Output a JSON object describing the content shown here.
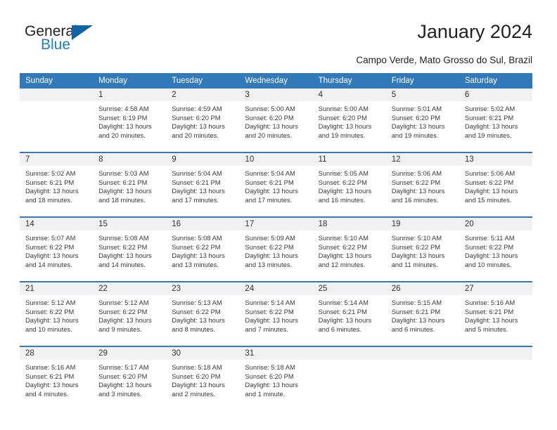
{
  "brand": {
    "word1": "General",
    "word2": "Blue",
    "color_dark": "#231f20",
    "color_blue": "#1b7fc4",
    "triangle_color": "#1064a5"
  },
  "header": {
    "title": "January 2024",
    "subtitle": "Campo Verde, Mato Grosso do Sul, Brazil"
  },
  "calendar": {
    "header_background": "#3179b8",
    "daynum_background": "#f1f1f1",
    "weekdays": [
      "Sunday",
      "Monday",
      "Tuesday",
      "Wednesday",
      "Thursday",
      "Friday",
      "Saturday"
    ],
    "weeks": [
      [
        {
          "day": "",
          "blank": true
        },
        {
          "day": "1",
          "sunrise": "Sunrise: 4:58 AM",
          "sunset": "Sunset: 6:19 PM",
          "daylight1": "Daylight: 13 hours",
          "daylight2": "and 20 minutes."
        },
        {
          "day": "2",
          "sunrise": "Sunrise: 4:59 AM",
          "sunset": "Sunset: 6:20 PM",
          "daylight1": "Daylight: 13 hours",
          "daylight2": "and 20 minutes."
        },
        {
          "day": "3",
          "sunrise": "Sunrise: 5:00 AM",
          "sunset": "Sunset: 6:20 PM",
          "daylight1": "Daylight: 13 hours",
          "daylight2": "and 20 minutes."
        },
        {
          "day": "4",
          "sunrise": "Sunrise: 5:00 AM",
          "sunset": "Sunset: 6:20 PM",
          "daylight1": "Daylight: 13 hours",
          "daylight2": "and 19 minutes."
        },
        {
          "day": "5",
          "sunrise": "Sunrise: 5:01 AM",
          "sunset": "Sunset: 6:20 PM",
          "daylight1": "Daylight: 13 hours",
          "daylight2": "and 19 minutes."
        },
        {
          "day": "6",
          "sunrise": "Sunrise: 5:02 AM",
          "sunset": "Sunset: 6:21 PM",
          "daylight1": "Daylight: 13 hours",
          "daylight2": "and 19 minutes."
        }
      ],
      [
        {
          "day": "7",
          "sunrise": "Sunrise: 5:02 AM",
          "sunset": "Sunset: 6:21 PM",
          "daylight1": "Daylight: 13 hours",
          "daylight2": "and 18 minutes."
        },
        {
          "day": "8",
          "sunrise": "Sunrise: 5:03 AM",
          "sunset": "Sunset: 6:21 PM",
          "daylight1": "Daylight: 13 hours",
          "daylight2": "and 18 minutes."
        },
        {
          "day": "9",
          "sunrise": "Sunrise: 5:04 AM",
          "sunset": "Sunset: 6:21 PM",
          "daylight1": "Daylight: 13 hours",
          "daylight2": "and 17 minutes."
        },
        {
          "day": "10",
          "sunrise": "Sunrise: 5:04 AM",
          "sunset": "Sunset: 6:21 PM",
          "daylight1": "Daylight: 13 hours",
          "daylight2": "and 17 minutes."
        },
        {
          "day": "11",
          "sunrise": "Sunrise: 5:05 AM",
          "sunset": "Sunset: 6:22 PM",
          "daylight1": "Daylight: 13 hours",
          "daylight2": "and 16 minutes."
        },
        {
          "day": "12",
          "sunrise": "Sunrise: 5:06 AM",
          "sunset": "Sunset: 6:22 PM",
          "daylight1": "Daylight: 13 hours",
          "daylight2": "and 16 minutes."
        },
        {
          "day": "13",
          "sunrise": "Sunrise: 5:06 AM",
          "sunset": "Sunset: 6:22 PM",
          "daylight1": "Daylight: 13 hours",
          "daylight2": "and 15 minutes."
        }
      ],
      [
        {
          "day": "14",
          "sunrise": "Sunrise: 5:07 AM",
          "sunset": "Sunset: 6:22 PM",
          "daylight1": "Daylight: 13 hours",
          "daylight2": "and 14 minutes."
        },
        {
          "day": "15",
          "sunrise": "Sunrise: 5:08 AM",
          "sunset": "Sunset: 6:22 PM",
          "daylight1": "Daylight: 13 hours",
          "daylight2": "and 14 minutes."
        },
        {
          "day": "16",
          "sunrise": "Sunrise: 5:08 AM",
          "sunset": "Sunset: 6:22 PM",
          "daylight1": "Daylight: 13 hours",
          "daylight2": "and 13 minutes."
        },
        {
          "day": "17",
          "sunrise": "Sunrise: 5:09 AM",
          "sunset": "Sunset: 6:22 PM",
          "daylight1": "Daylight: 13 hours",
          "daylight2": "and 13 minutes."
        },
        {
          "day": "18",
          "sunrise": "Sunrise: 5:10 AM",
          "sunset": "Sunset: 6:22 PM",
          "daylight1": "Daylight: 13 hours",
          "daylight2": "and 12 minutes."
        },
        {
          "day": "19",
          "sunrise": "Sunrise: 5:10 AM",
          "sunset": "Sunset: 6:22 PM",
          "daylight1": "Daylight: 13 hours",
          "daylight2": "and 11 minutes."
        },
        {
          "day": "20",
          "sunrise": "Sunrise: 5:11 AM",
          "sunset": "Sunset: 6:22 PM",
          "daylight1": "Daylight: 13 hours",
          "daylight2": "and 10 minutes."
        }
      ],
      [
        {
          "day": "21",
          "sunrise": "Sunrise: 5:12 AM",
          "sunset": "Sunset: 6:22 PM",
          "daylight1": "Daylight: 13 hours",
          "daylight2": "and 10 minutes."
        },
        {
          "day": "22",
          "sunrise": "Sunrise: 5:12 AM",
          "sunset": "Sunset: 6:22 PM",
          "daylight1": "Daylight: 13 hours",
          "daylight2": "and 9 minutes."
        },
        {
          "day": "23",
          "sunrise": "Sunrise: 5:13 AM",
          "sunset": "Sunset: 6:22 PM",
          "daylight1": "Daylight: 13 hours",
          "daylight2": "and 8 minutes."
        },
        {
          "day": "24",
          "sunrise": "Sunrise: 5:14 AM",
          "sunset": "Sunset: 6:22 PM",
          "daylight1": "Daylight: 13 hours",
          "daylight2": "and 7 minutes."
        },
        {
          "day": "25",
          "sunrise": "Sunrise: 5:14 AM",
          "sunset": "Sunset: 6:21 PM",
          "daylight1": "Daylight: 13 hours",
          "daylight2": "and 6 minutes."
        },
        {
          "day": "26",
          "sunrise": "Sunrise: 5:15 AM",
          "sunset": "Sunset: 6:21 PM",
          "daylight1": "Daylight: 13 hours",
          "daylight2": "and 6 minutes."
        },
        {
          "day": "27",
          "sunrise": "Sunrise: 5:16 AM",
          "sunset": "Sunset: 6:21 PM",
          "daylight1": "Daylight: 13 hours",
          "daylight2": "and 5 minutes."
        }
      ],
      [
        {
          "day": "28",
          "sunrise": "Sunrise: 5:16 AM",
          "sunset": "Sunset: 6:21 PM",
          "daylight1": "Daylight: 13 hours",
          "daylight2": "and 4 minutes."
        },
        {
          "day": "29",
          "sunrise": "Sunrise: 5:17 AM",
          "sunset": "Sunset: 6:20 PM",
          "daylight1": "Daylight: 13 hours",
          "daylight2": "and 3 minutes."
        },
        {
          "day": "30",
          "sunrise": "Sunrise: 5:18 AM",
          "sunset": "Sunset: 6:20 PM",
          "daylight1": "Daylight: 13 hours",
          "daylight2": "and 2 minutes."
        },
        {
          "day": "31",
          "sunrise": "Sunrise: 5:18 AM",
          "sunset": "Sunset: 6:20 PM",
          "daylight1": "Daylight: 13 hours",
          "daylight2": "and 1 minute."
        },
        {
          "day": "",
          "blank": true
        },
        {
          "day": "",
          "blank": true
        },
        {
          "day": "",
          "blank": true
        }
      ]
    ]
  }
}
